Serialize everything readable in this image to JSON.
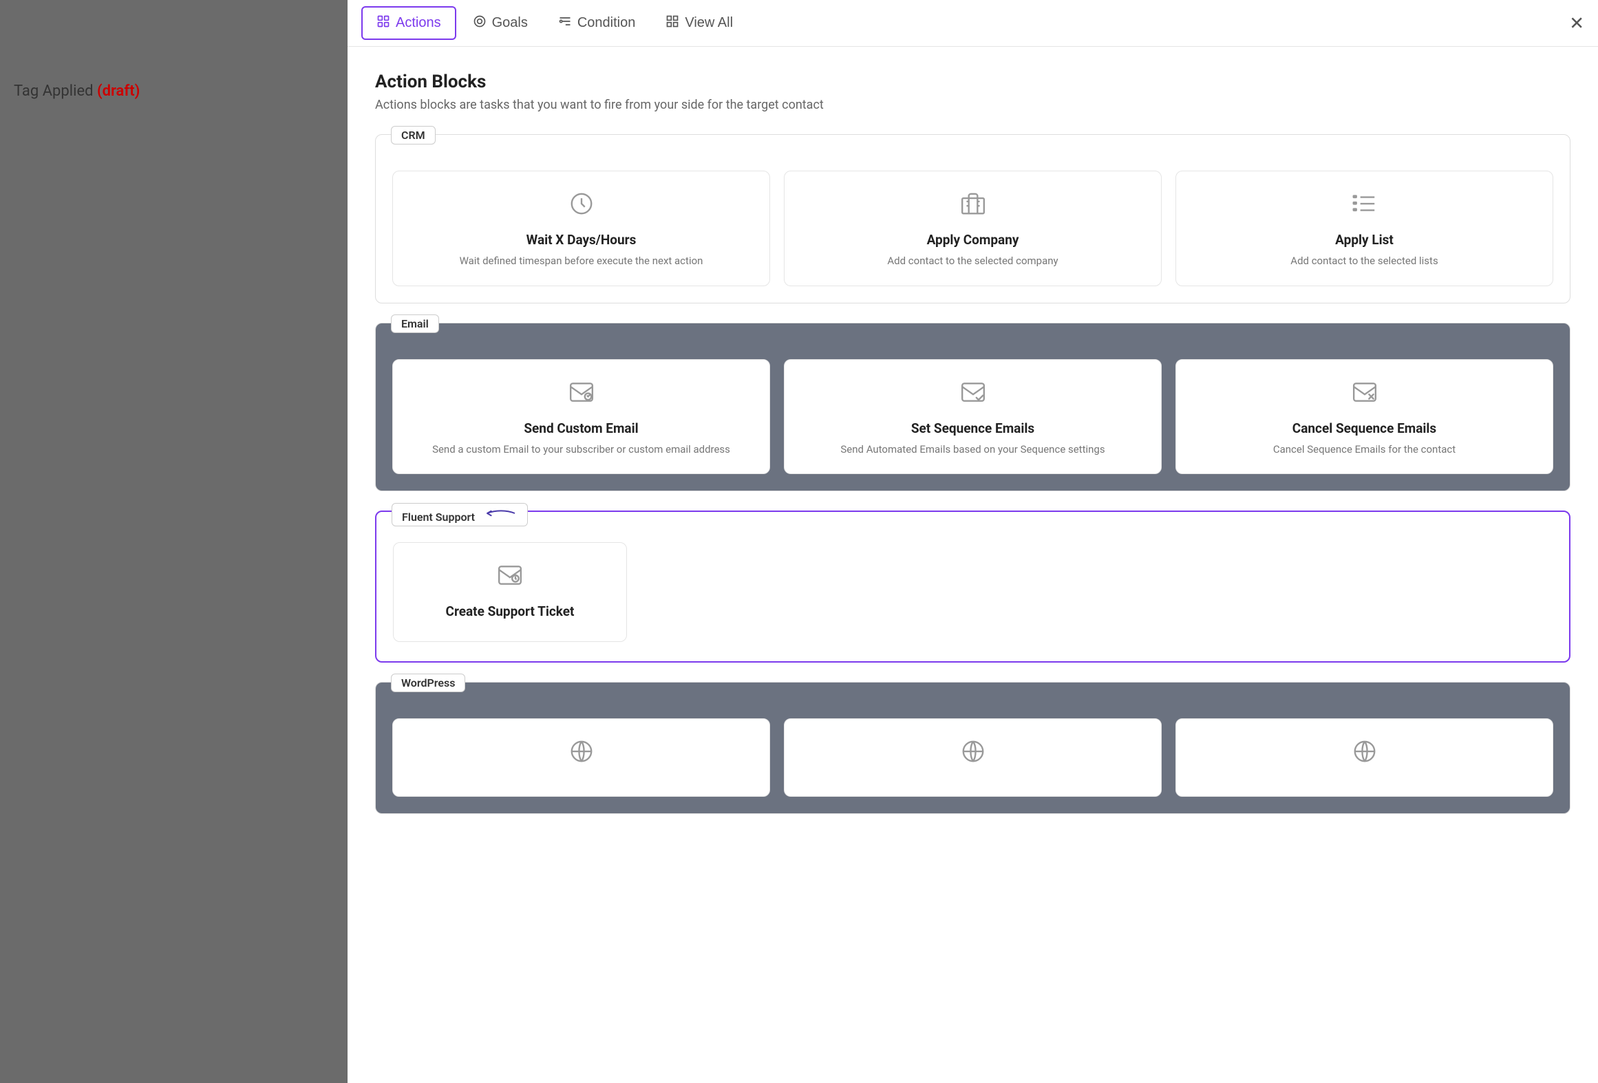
{
  "background": {
    "tag_text": "Tag Applied",
    "tag_status": "(draft)"
  },
  "nav": {
    "tabs": [
      {
        "id": "actions",
        "label": "Actions",
        "icon": "⊡",
        "active": true
      },
      {
        "id": "goals",
        "label": "Goals",
        "icon": "◎",
        "active": false
      },
      {
        "id": "condition",
        "label": "Condition",
        "icon": "⧉",
        "active": false
      },
      {
        "id": "view-all",
        "label": "View All",
        "icon": "⊞",
        "active": false
      }
    ],
    "close_label": "✕"
  },
  "content": {
    "title": "Action Blocks",
    "description": "Actions blocks are tasks that you want to fire from your side for the target contact",
    "groups": [
      {
        "id": "crm",
        "label": "CRM",
        "dark": false,
        "cards": [
          {
            "id": "wait-days-hours",
            "title": "Wait X Days/Hours",
            "desc": "Wait defined timespan before execute the next action",
            "icon": "clock"
          },
          {
            "id": "apply-company",
            "title": "Apply Company",
            "desc": "Add contact to the selected company",
            "icon": "company"
          },
          {
            "id": "apply-list",
            "title": "Apply List",
            "desc": "Add contact to the selected lists",
            "icon": "list"
          }
        ]
      },
      {
        "id": "email",
        "label": "Email",
        "dark": true,
        "cards": [
          {
            "id": "send-custom-email",
            "title": "Send Custom Email",
            "desc": "Send a custom Email to your subscriber or custom email address",
            "icon": "email-send"
          },
          {
            "id": "set-sequence-emails",
            "title": "Set Sequence Emails",
            "desc": "Send Automated Emails based on your Sequence settings",
            "icon": "email-sequence"
          },
          {
            "id": "cancel-sequence-emails",
            "title": "Cancel Sequence Emails",
            "desc": "Cancel Sequence Emails for the contact",
            "icon": "email-cancel"
          }
        ]
      },
      {
        "id": "fluent-support",
        "label": "Fluent Support",
        "dark": false,
        "fluent": true,
        "arrow": "←",
        "cards": [
          {
            "id": "create-support-ticket",
            "title": "Create Support Ticket",
            "desc": "",
            "icon": "ticket"
          }
        ]
      },
      {
        "id": "wordpress",
        "label": "WordPress",
        "dark": true,
        "cards": [
          {
            "id": "wp-card-1",
            "title": "",
            "desc": "",
            "icon": "wp"
          },
          {
            "id": "wp-card-2",
            "title": "",
            "desc": "",
            "icon": "wp"
          },
          {
            "id": "wp-card-3",
            "title": "",
            "desc": "",
            "icon": "wp"
          }
        ]
      }
    ]
  }
}
